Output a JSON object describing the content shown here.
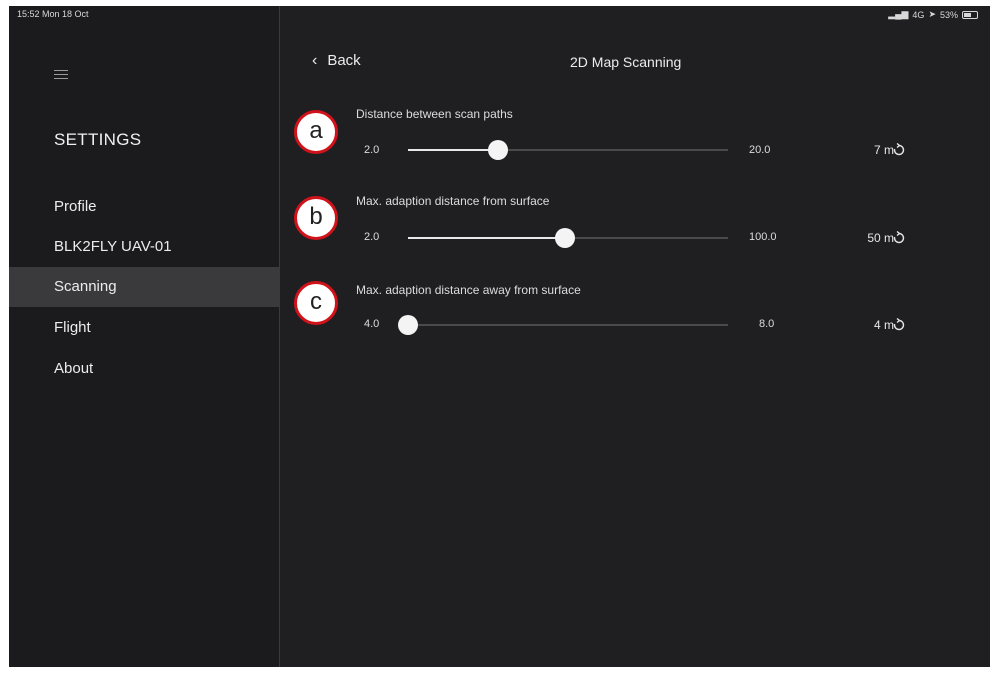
{
  "status_bar": {
    "time": "15:52  Mon 18 Oct",
    "network": "4G",
    "battery": "53%"
  },
  "sidebar": {
    "title": "SETTINGS",
    "items": [
      {
        "label": "Profile",
        "active": false
      },
      {
        "label": "BLK2FLY UAV-01",
        "active": false
      },
      {
        "label": "Scanning",
        "active": true
      },
      {
        "label": "Flight",
        "active": false
      },
      {
        "label": "About",
        "active": false
      }
    ]
  },
  "header": {
    "back_label": "Back",
    "title": "2D Map Scanning"
  },
  "settings": [
    {
      "callout": "a",
      "label": "Distance between scan paths",
      "min": "2.0",
      "max": "20.0",
      "value": "7 m",
      "fraction": 0.28
    },
    {
      "callout": "b",
      "label": "Max. adaption distance from surface",
      "min": "2.0",
      "max": "100.0",
      "value": "50 m",
      "fraction": 0.49
    },
    {
      "callout": "c",
      "label": "Max. adaption distance away from surface",
      "min": "4.0",
      "max": "8.0",
      "value": "4 m",
      "fraction": 0.0
    }
  ],
  "icons": {
    "menu": "hamburger-icon",
    "back": "chevron-left-icon",
    "reset": "reset-arrow-icon"
  },
  "colors": {
    "background": "#1f1f21",
    "sidebar": "#1b1b1d",
    "active_item": "#3a3a3c",
    "callout_border": "#d0121b"
  }
}
